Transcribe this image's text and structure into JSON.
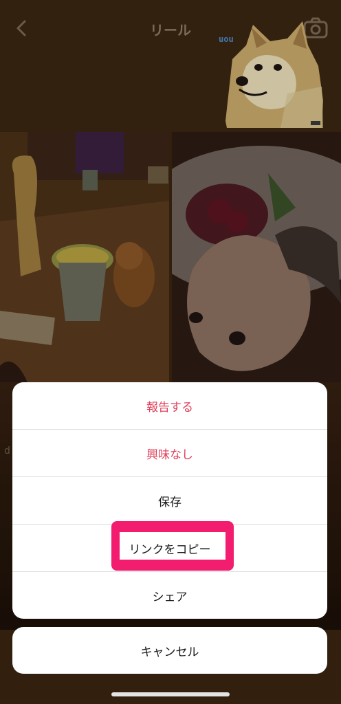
{
  "header": {
    "title": "リール",
    "back_icon": "chevron-left-icon",
    "camera_icon": "camera-icon"
  },
  "sticker": {
    "text": "uou"
  },
  "side_text": "d",
  "action_sheet": {
    "items": [
      {
        "label": "報告する",
        "color": "#e0405a"
      },
      {
        "label": "興味なし",
        "color": "#e0405a"
      },
      {
        "label": "保存",
        "color": "#1a1a1a"
      },
      {
        "label": "リンクをコピー",
        "color": "#1a1a1a",
        "highlighted": true,
        "highlight_color": "#f21d6e"
      },
      {
        "label": "シェア",
        "color": "#1a1a1a"
      }
    ],
    "cancel_label": "キャンセル"
  }
}
